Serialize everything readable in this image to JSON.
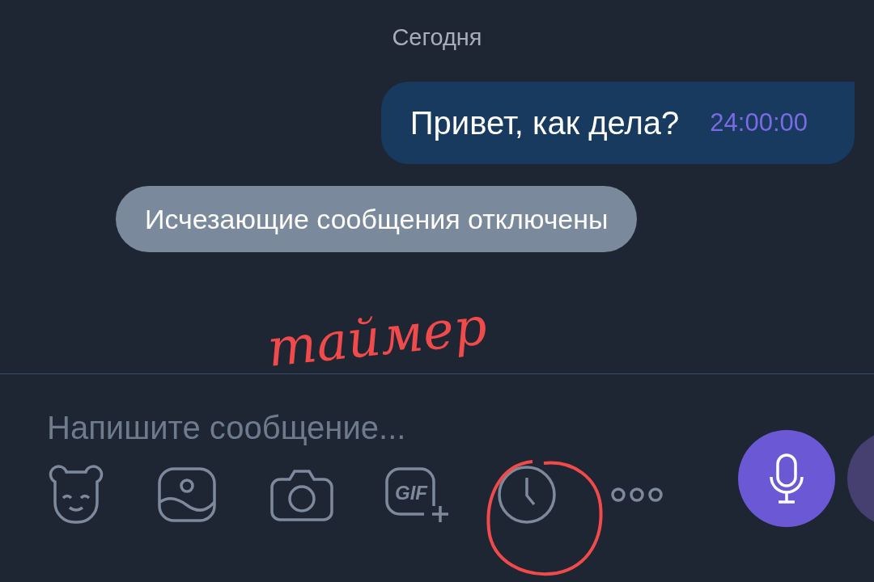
{
  "date_divider": "Сегодня",
  "messages": [
    {
      "kind": "outgoing",
      "text": "Привет, как дела?",
      "time": "24:00:00"
    },
    {
      "kind": "system",
      "text": "Исчезающие сообщения отключены"
    }
  ],
  "composer": {
    "placeholder": "Напишите сообщение..."
  },
  "toolbar": [
    {
      "kind": "sticker"
    },
    {
      "kind": "gallery"
    },
    {
      "kind": "camera"
    },
    {
      "kind": "gif",
      "label": "GIF"
    },
    {
      "kind": "timer"
    },
    {
      "kind": "more"
    }
  ],
  "annotation": {
    "text": "таймер"
  }
}
